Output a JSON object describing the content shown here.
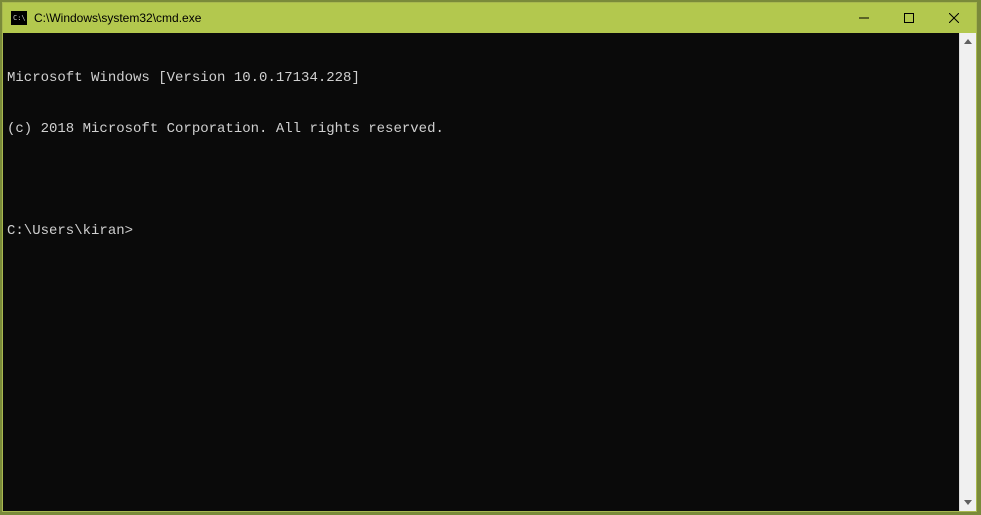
{
  "window": {
    "title": "C:\\Windows\\system32\\cmd.exe"
  },
  "terminal": {
    "line1": "Microsoft Windows [Version 10.0.17134.228]",
    "line2": "(c) 2018 Microsoft Corporation. All rights reserved.",
    "blank": "",
    "prompt": "C:\\Users\\kiran>"
  }
}
